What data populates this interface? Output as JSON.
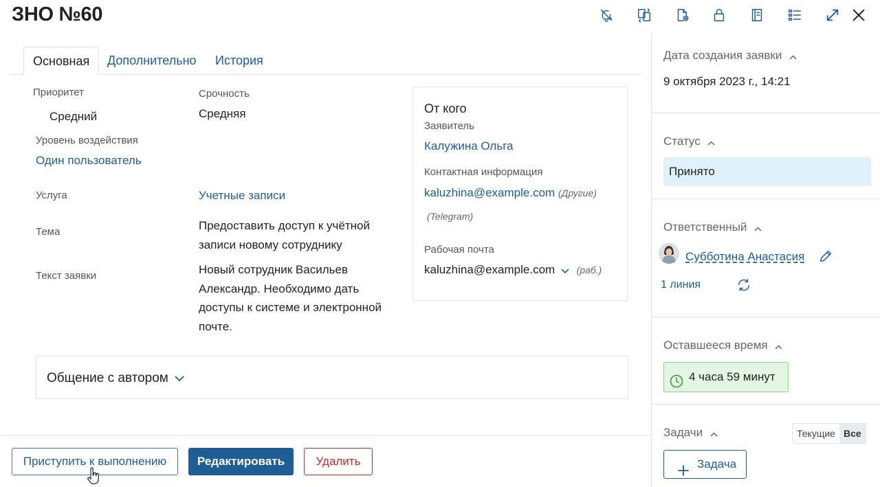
{
  "header": {
    "title": "ЗНО №60",
    "icons": [
      "bell-off-icon",
      "transfer-icon",
      "document-icon",
      "lock-icon",
      "book-icon",
      "list-settings-icon",
      "expand-icon",
      "close-icon"
    ]
  },
  "tabs": [
    {
      "label": "Основная",
      "active": true
    },
    {
      "label": "Дополнительно",
      "active": false
    },
    {
      "label": "История",
      "active": false
    }
  ],
  "main": {
    "priority_label": "Приоритет",
    "priority_value": "Средний",
    "urgency_label": "Срочность",
    "urgency_value": "Средняя",
    "impact_label": "Уровень воздействия",
    "impact_value": "Один пользователь",
    "service_label": "Услуга",
    "service_value": "Учетные записи",
    "topic_label": "Тема",
    "topic_value": "Предоставить доступ к учётной записи новому сотруднику",
    "text_label": "Текст заявки",
    "text_value": "Новый сотрудник Васильев Александр. Необходимо дать доступы к системе и электронной почте."
  },
  "from_card": {
    "title": "От кого",
    "requester_label": "Заявитель",
    "requester_value": "Калужина Ольга",
    "contact_label": "Контактная информация",
    "contact_email": "kaluzhina@example.com",
    "contact_email_note": "(Другие)",
    "contact_telegram_note": "(Telegram)",
    "work_email_label": "Рабочая почта",
    "work_email_value": "kaluzhina@example.com",
    "work_email_note": "(раб.)"
  },
  "communication": {
    "title": "Общение с автором"
  },
  "footer": {
    "start_button": "Приступить к выполнению",
    "edit_button": "Редактировать",
    "delete_button": "Удалить"
  },
  "right_panel": {
    "created_label": "Дата создания заявки",
    "created_value": "9 октября 2023 г., 14:21",
    "status_label": "Статус",
    "status_value": "Принято",
    "responsible_label": "Ответственный",
    "responsible_name": "Субботина Анастасия",
    "line_value": "1 линия",
    "remaining_label": "Оставшееся время",
    "remaining_value": "4 часа 59 минут",
    "tasks_label": "Задачи",
    "tasks_filter_current": "Текущие",
    "tasks_filter_all": "Все",
    "add_task_button": "Задача"
  },
  "colors": {
    "link": "#1f5d95",
    "primary": "#1f5d95",
    "danger": "#d0262d",
    "status_bg": "#dff1f9",
    "timer_bg": "#e4f5e4",
    "timer_border": "#8fcf8f",
    "border": "#dde3e8"
  }
}
